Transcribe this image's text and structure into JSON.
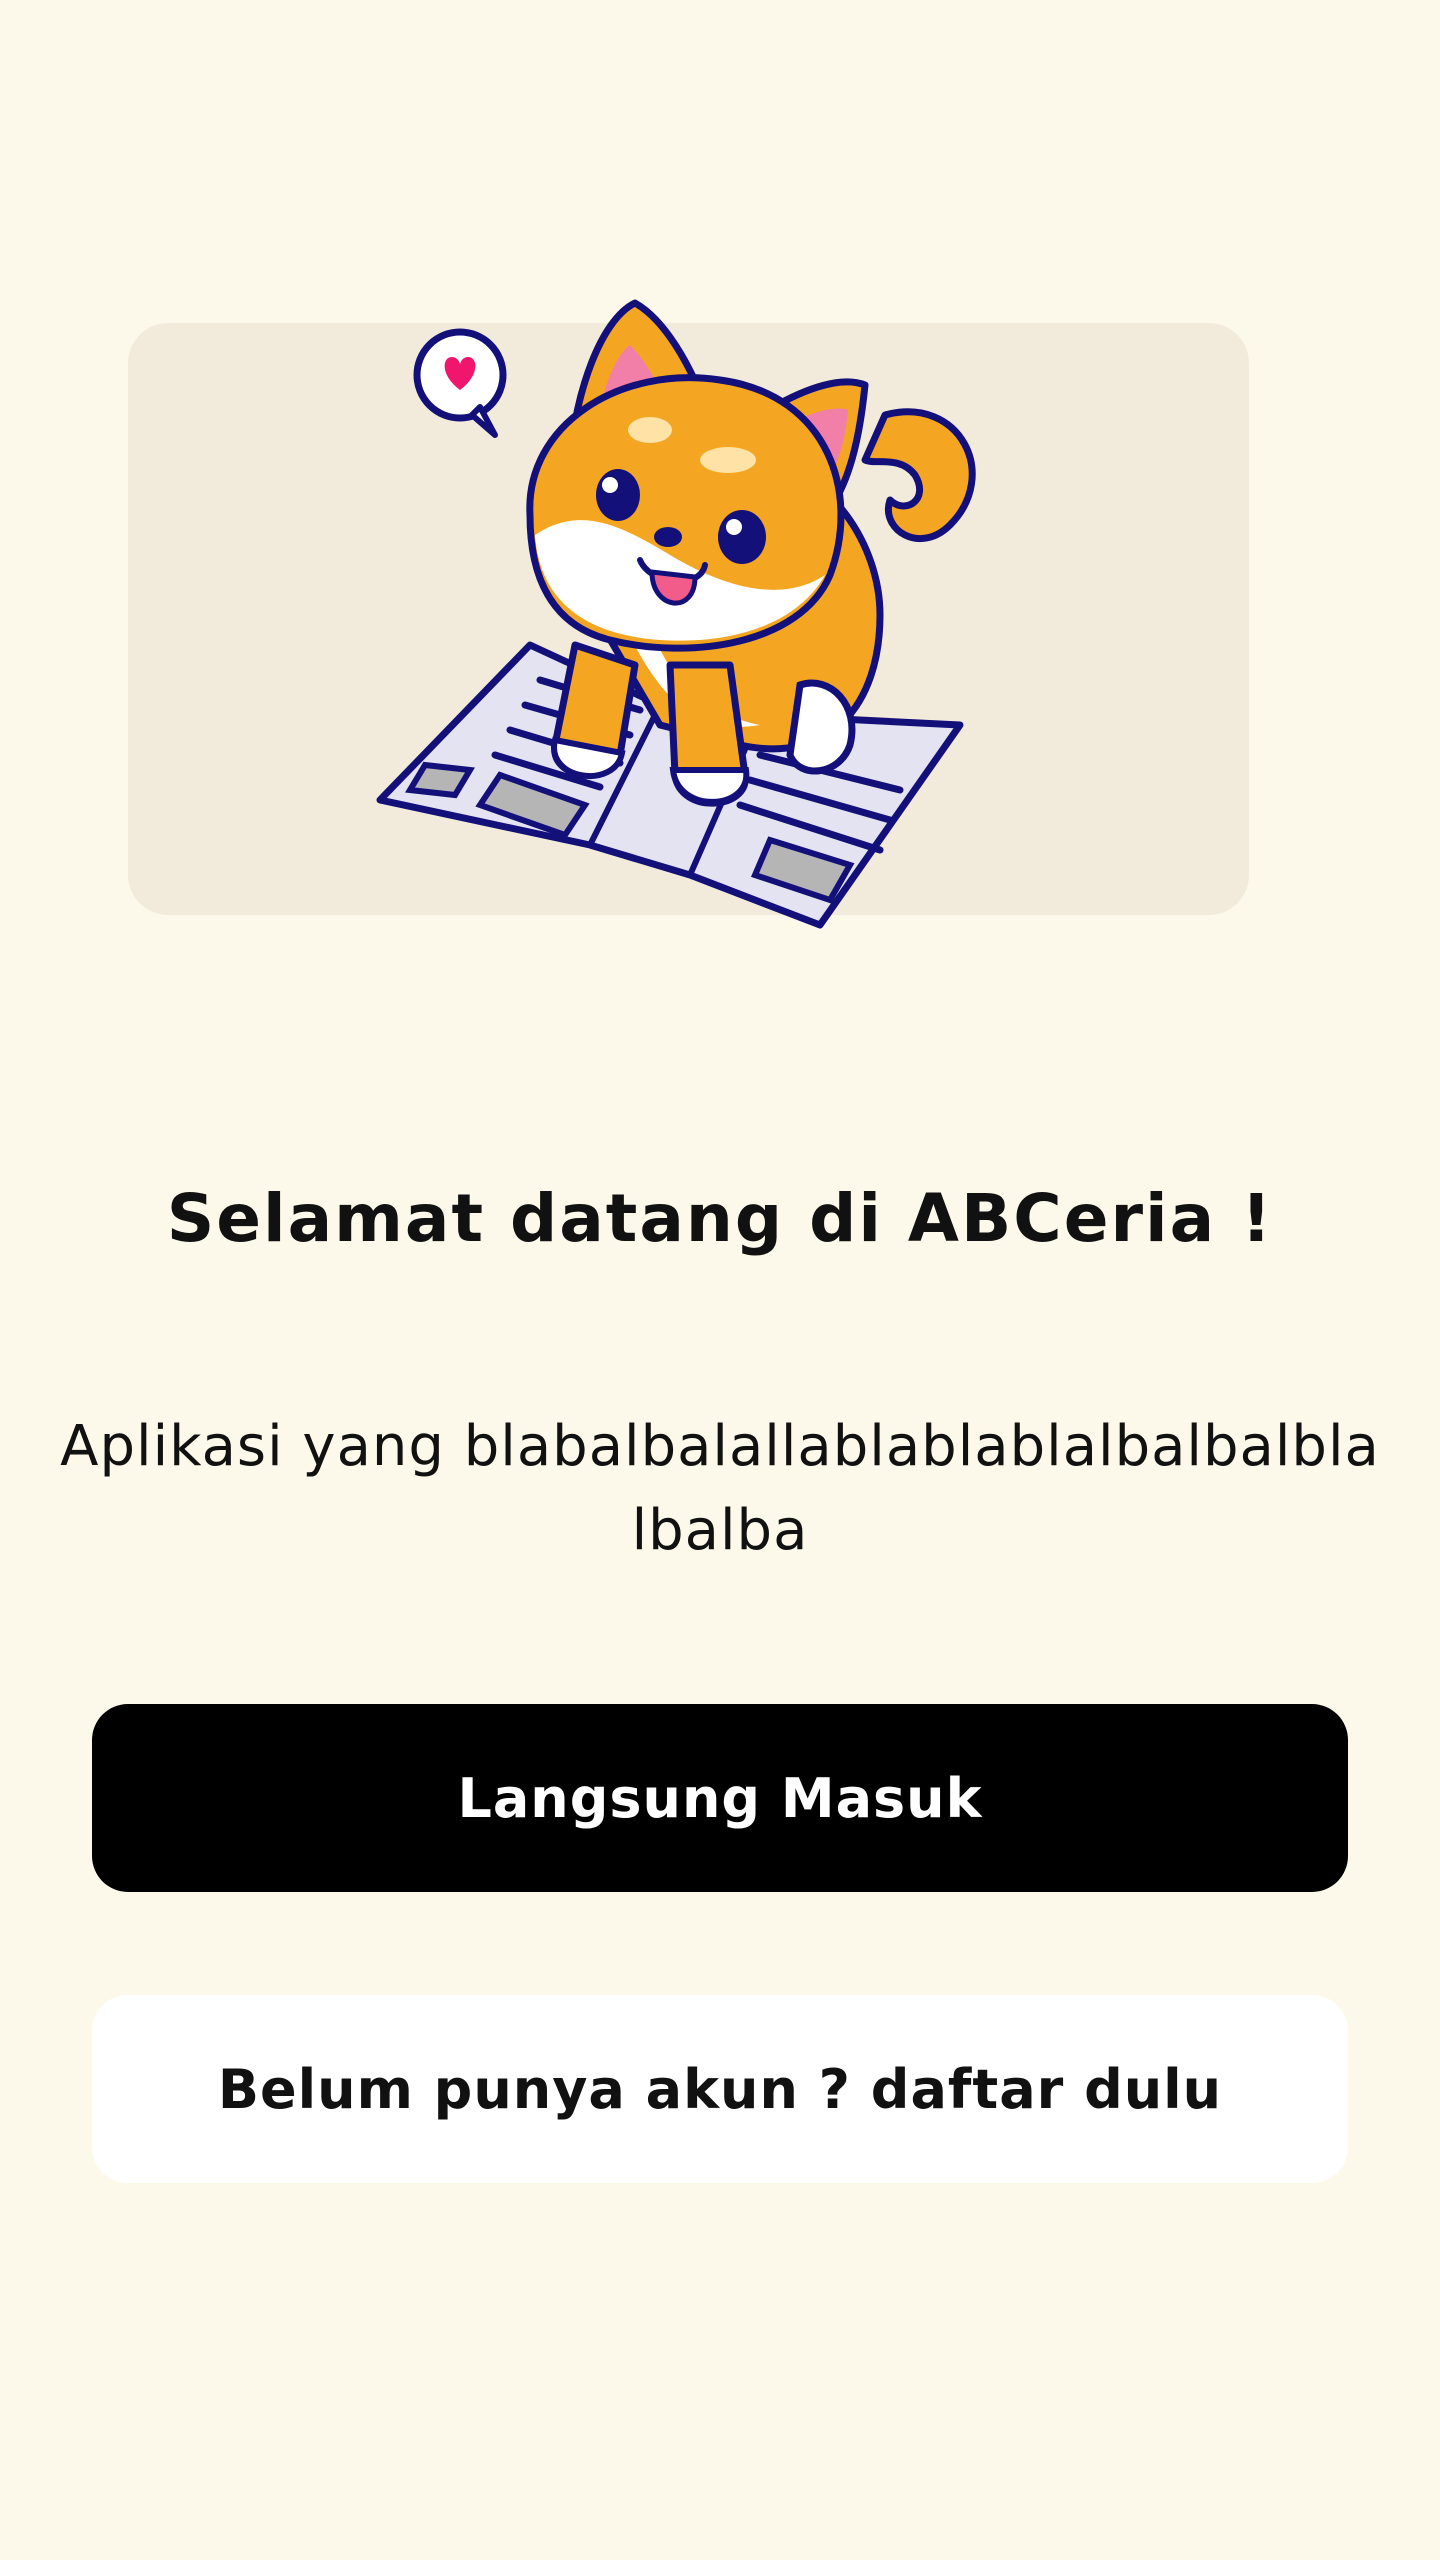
{
  "screen": {
    "background_color": "#FDF9EA"
  },
  "hero": {
    "card_color": "#F2EBDC",
    "illustration": "shiba-dog-on-newspaper-illustration",
    "speech_bubble_icon": "heart-icon"
  },
  "welcome": {
    "title": "Selamat datang di ABCeria !",
    "subtitle": "Aplikasi yang blabalbalallablablablalbalbalblalbalba"
  },
  "actions": {
    "login_label": "Langsung Masuk",
    "register_label": "Belum punya akun ? daftar dulu"
  },
  "colors": {
    "primary_button": "#000000",
    "secondary_button": "#FFFFFF",
    "text": "#111111"
  }
}
